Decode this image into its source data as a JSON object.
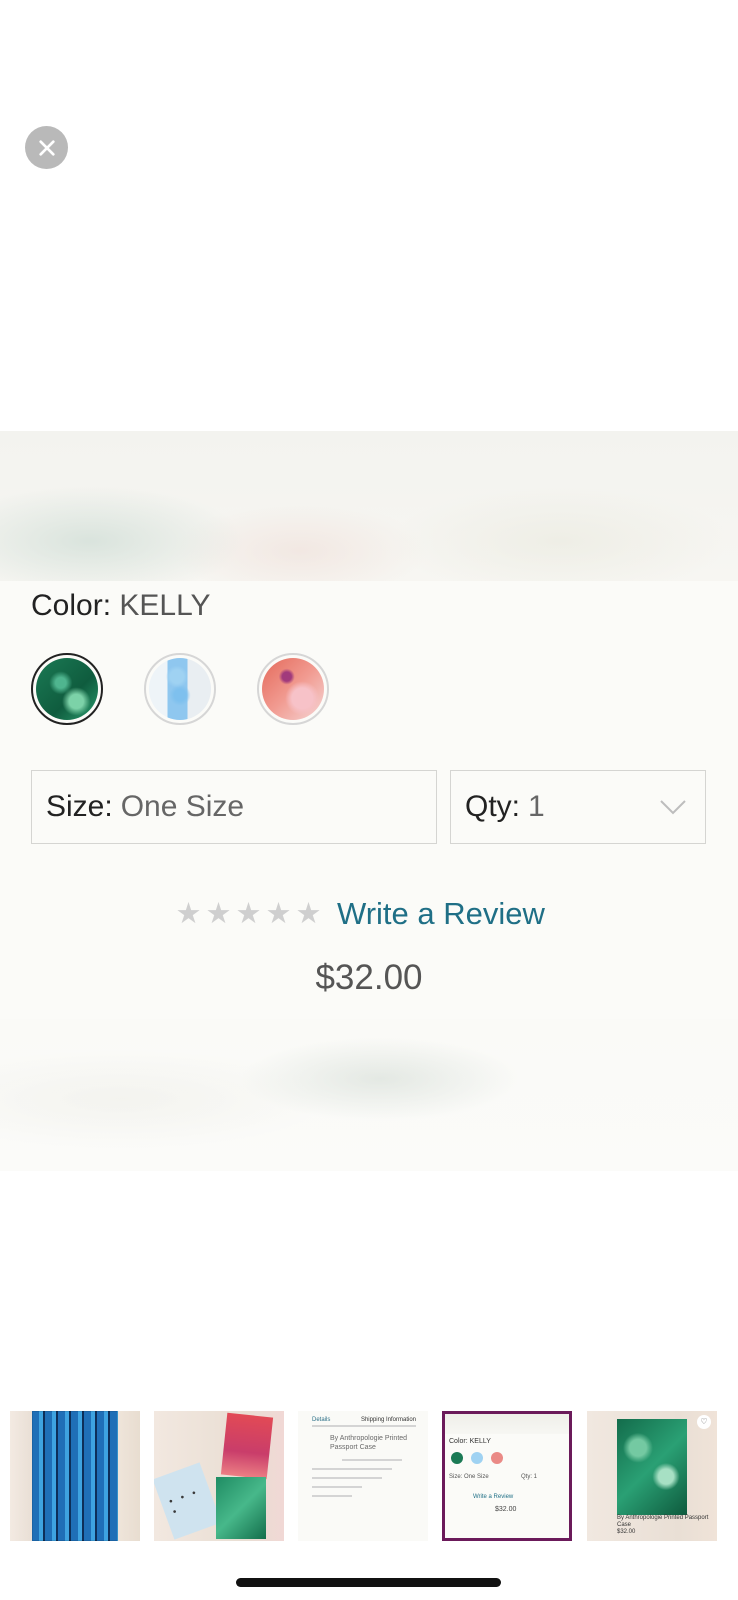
{
  "close": {
    "icon": "close-icon"
  },
  "product": {
    "color_label": "Color:",
    "color_value": "KELLY",
    "swatches": [
      {
        "name": "kelly",
        "selected": true
      },
      {
        "name": "blue",
        "selected": false
      },
      {
        "name": "pink",
        "selected": false
      }
    ],
    "size_label": "Size:",
    "size_value": "One Size",
    "qty_label": "Qty:",
    "qty_value": "1",
    "review_label": "Write a Review",
    "rating_stars": 5,
    "price": "$32.00"
  },
  "thumbnails": {
    "selected_index": 3,
    "doc_thumb": {
      "tab1": "Details",
      "tab2": "Shipping Information",
      "title": "By Anthropologie Printed Passport Case",
      "price_line": "$32.00"
    },
    "mini": {
      "color": "Color: KELLY",
      "size": "Size: One Size",
      "qty": "Qty: 1",
      "review": "Write a Review",
      "price": "$32.00"
    },
    "last": {
      "caption": "By Anthropologie Printed Passport Case",
      "price": "$32.00"
    }
  },
  "colors": {
    "accent": "#1f6f86",
    "selected_border": "#6b1a5a"
  }
}
